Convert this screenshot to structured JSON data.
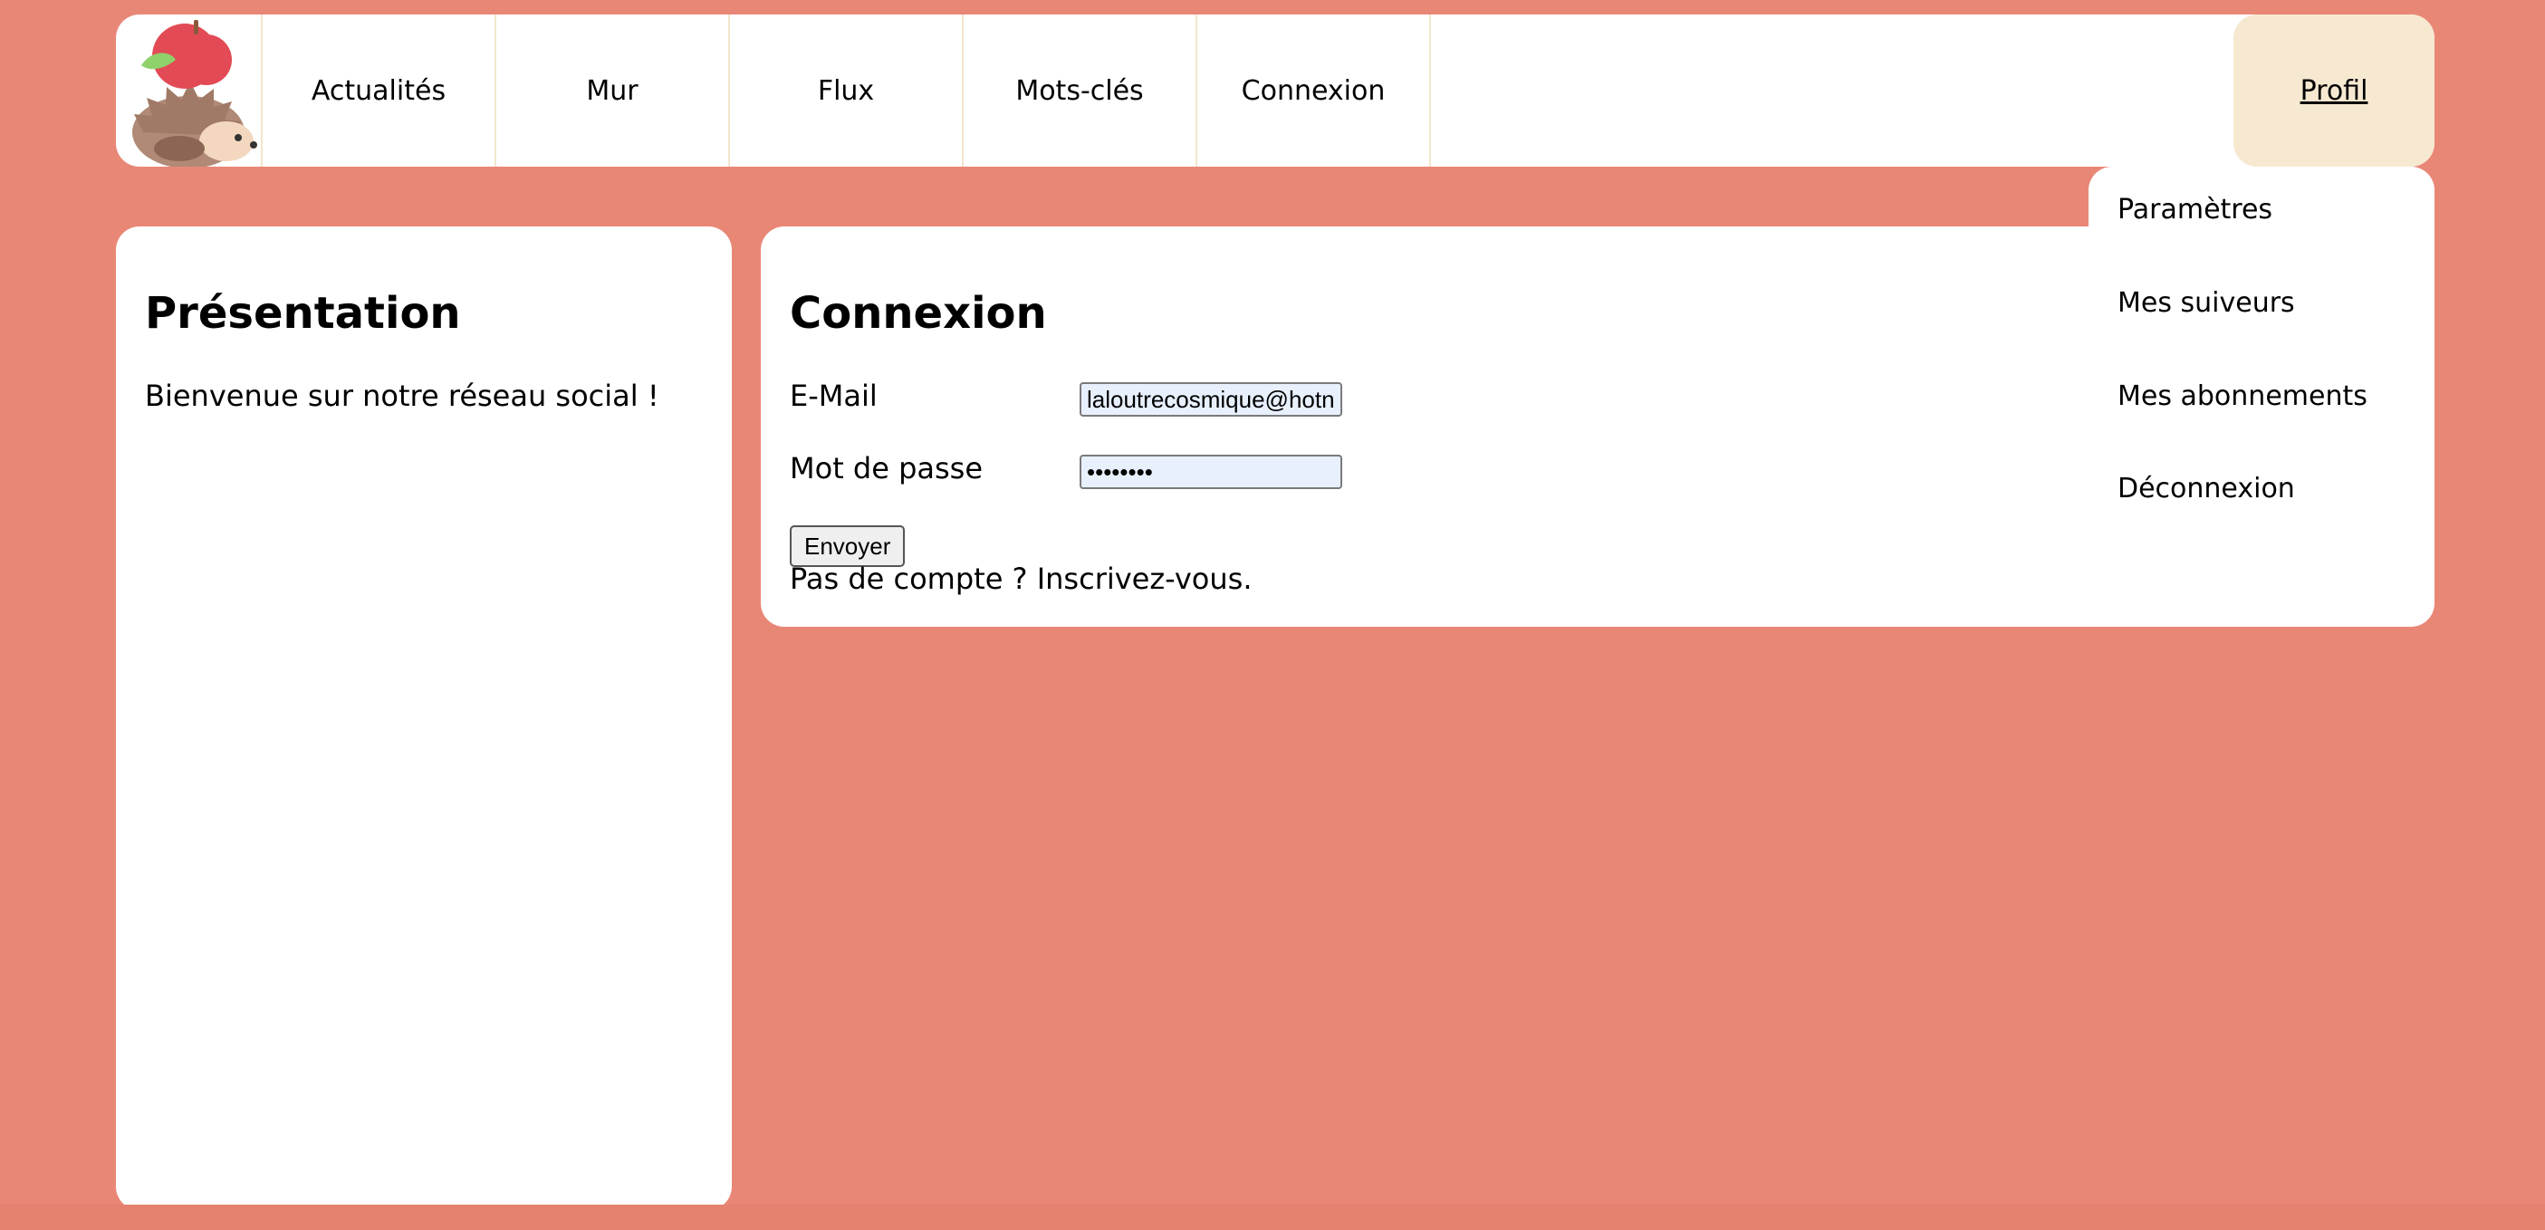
{
  "header": {
    "logo_icon": "apple-hedgehog-logo",
    "nav": [
      {
        "label": "Actualités"
      },
      {
        "label": "Mur"
      },
      {
        "label": "Flux"
      },
      {
        "label": "Mots-clés"
      },
      {
        "label": "Connexion"
      }
    ],
    "profile_label": "Profil"
  },
  "dropdown": {
    "items": [
      {
        "label": "Paramètres"
      },
      {
        "label": "Mes suiveurs"
      },
      {
        "label": "Mes abonnements"
      },
      {
        "label": "Déconnexion"
      }
    ]
  },
  "presentation": {
    "title": "Présentation",
    "text": "Bienvenue sur notre réseau social !"
  },
  "login": {
    "title": "Connexion",
    "email_label": "E-Mail",
    "email_value": "laloutrecosmique@hotn",
    "password_label": "Mot de passe",
    "password_value": "••••••••",
    "submit_label": "Envoyer",
    "signup_text": "Pas de compte ? Inscrivez-vous."
  },
  "colors": {
    "background": "#e98777",
    "panel": "#ffffff",
    "profile_highlight": "#f7e9d1"
  }
}
